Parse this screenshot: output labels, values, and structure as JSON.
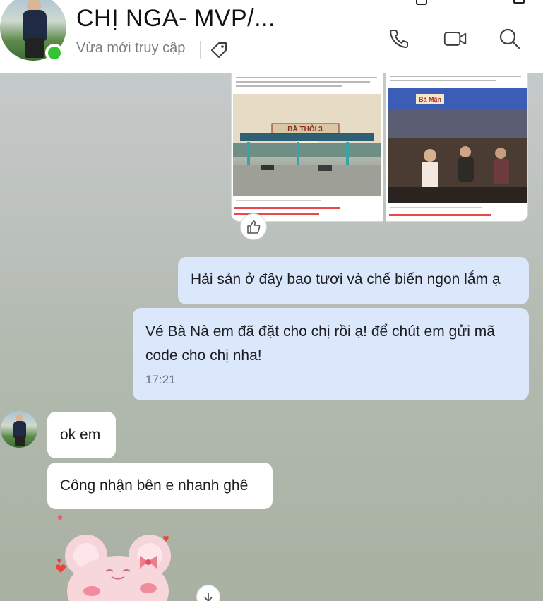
{
  "header": {
    "contact_name": "CHỊ NGA- MVP/...",
    "status": "Vừa mới truy cập",
    "icons": [
      "tag-icon",
      "phone-icon",
      "video-call-icon",
      "search-icon"
    ]
  },
  "images": {
    "left": {
      "sign_text": "BÀ THỎI 3"
    },
    "right": {
      "sign_text": "Bà Mận"
    }
  },
  "messages": [
    {
      "from": "me",
      "text": "Hải sản ở đây bao tươi và chế biến ngon lắm ạ"
    },
    {
      "from": "me",
      "text": "Vé Bà Nà em đã đặt cho chị rồi ạ! để chút em gửi mã code cho chị nha!",
      "time": "17:21"
    },
    {
      "from": "them",
      "text": "ok em"
    },
    {
      "from": "them",
      "text": "Công nhận bên e nhanh ghê"
    }
  ],
  "colors": {
    "my_bubble": "#dbe7fb",
    "their_bubble": "#ffffff",
    "online": "#35c233"
  }
}
